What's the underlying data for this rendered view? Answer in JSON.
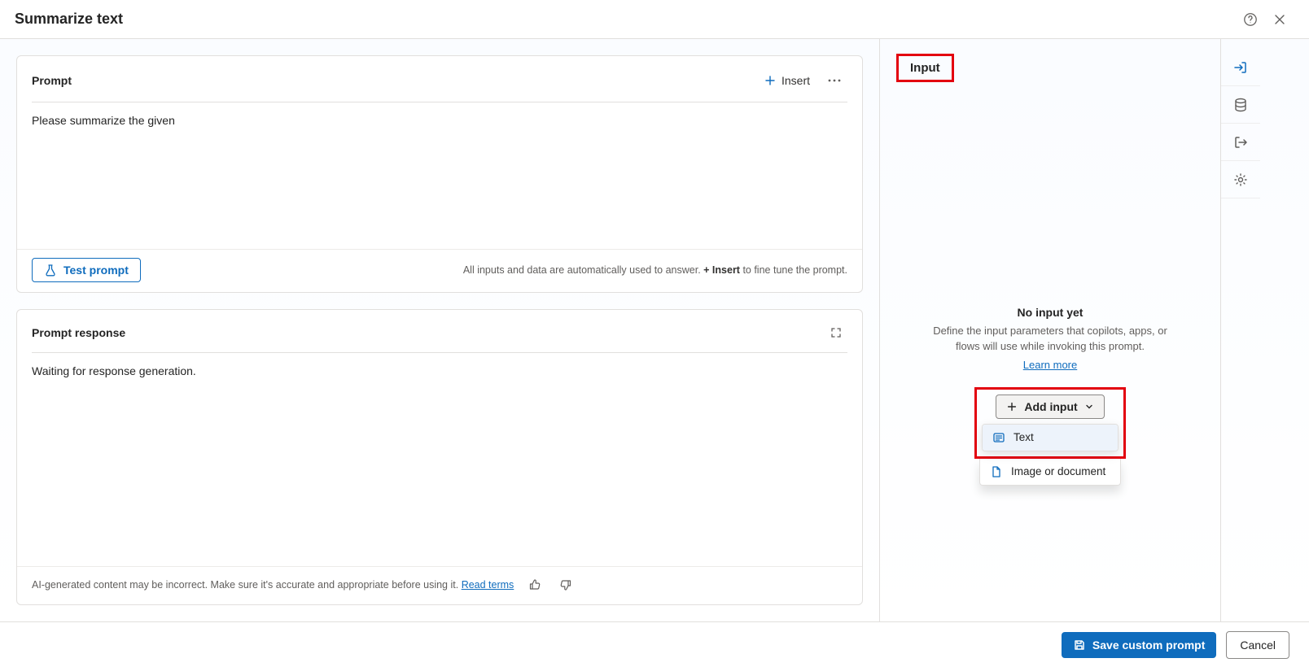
{
  "header": {
    "title": "Summarize text"
  },
  "prompt_card": {
    "title": "Prompt",
    "insert_label": "Insert",
    "text": "Please summarize the given",
    "test_label": "Test prompt",
    "footer_note_prefix": "All inputs and data are automatically used to answer. ",
    "footer_note_bold": "+ Insert",
    "footer_note_suffix": " to fine tune the prompt."
  },
  "response_card": {
    "title": "Prompt response",
    "body": "Waiting for response generation.",
    "disclaimer_prefix": "AI-generated content may be incorrect. Make sure it's accurate and appropriate before using it. ",
    "disclaimer_link": "Read terms"
  },
  "right_panel": {
    "tab_label": "Input",
    "empty_title": "No input yet",
    "empty_desc": "Define the input parameters that copilots, apps, or flows will use while invoking this prompt.",
    "learn_more": "Learn more",
    "add_input_label": "Add input",
    "options": [
      {
        "label": "Text",
        "icon": "text"
      },
      {
        "label": "Image or document",
        "icon": "doc"
      }
    ]
  },
  "footer": {
    "save_label": "Save custom prompt",
    "cancel_label": "Cancel"
  }
}
